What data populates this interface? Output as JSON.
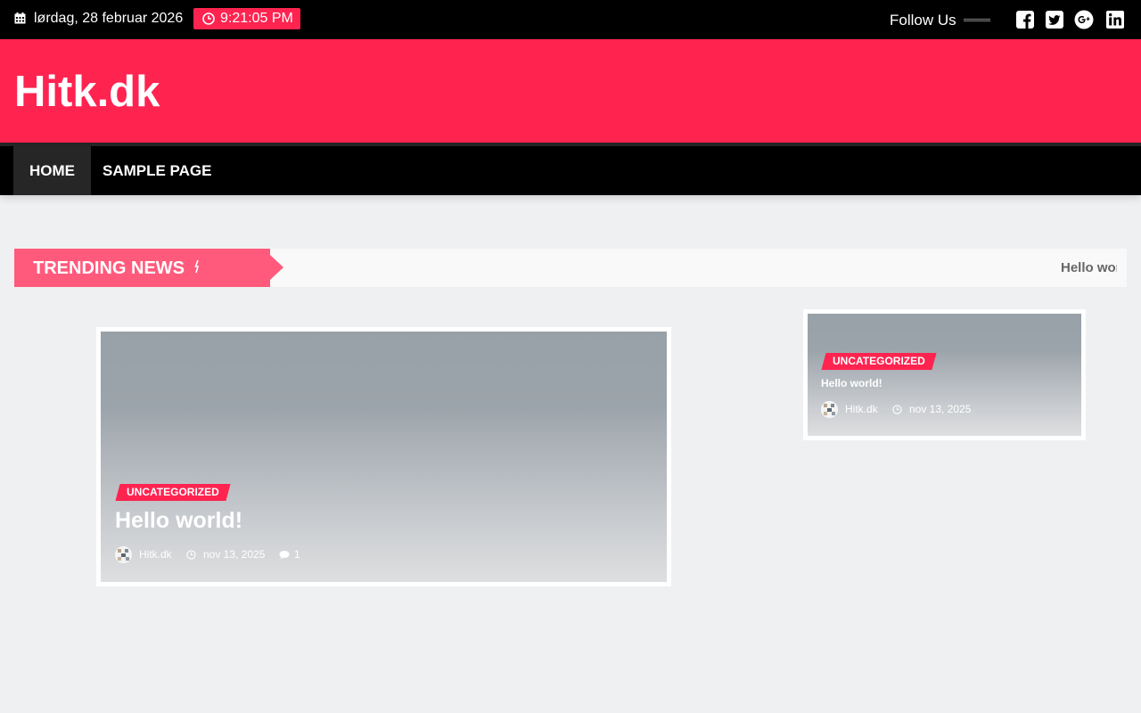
{
  "topbar": {
    "date": "lørdag, 28 februar 2026",
    "time": "9:21:05 PM",
    "follow_label": "Follow Us",
    "social": [
      "facebook-square-icon",
      "twitter-square-icon",
      "google-plus-icon",
      "linkedin-icon"
    ]
  },
  "header": {
    "site_title": "Hitk.dk"
  },
  "nav": {
    "items": [
      "HOME",
      "SAMPLE PAGE"
    ]
  },
  "trending": {
    "label": "TRENDING NEWS",
    "ticker": "Hello wor"
  },
  "main_post": {
    "category": "UNCATEGORIZED",
    "title": "Hello world!",
    "author": "Hitk.dk",
    "date": "nov 13, 2025",
    "comments": "1"
  },
  "side_post": {
    "category": "UNCATEGORIZED",
    "title": "Hello world!",
    "author": "Hitk.dk",
    "date": "nov 13, 2025"
  },
  "colors": {
    "accent": "#ff2350",
    "trending_label": "#ff5a7c",
    "bar": "#000000",
    "nav_active": "#262626"
  }
}
